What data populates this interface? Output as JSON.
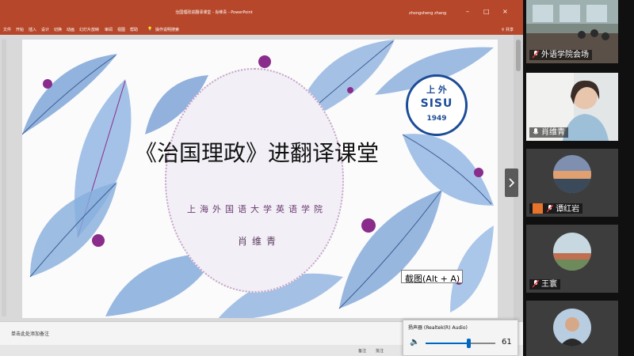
{
  "window": {
    "title": "治国理政进翻译课堂 - 肖维青 - PowerPoint",
    "user_name": "zhongsheng zhang"
  },
  "ribbon": {
    "tabs": [
      "文件",
      "开始",
      "插入",
      "设计",
      "切换",
      "动画",
      "幻灯片放映",
      "审阅",
      "视图",
      "帮助"
    ],
    "tell_me": "操作说明搜索",
    "share": "共享"
  },
  "slide": {
    "title": "《治国理政》进翻译课堂",
    "subtitle": "上海外国语大学英语学院",
    "author": "肖维青",
    "logo": {
      "top": "上 外",
      "middle": "SISU",
      "year": "1949"
    }
  },
  "tooltip": "截图(Alt + A)",
  "notes_placeholder": "单击此处添加备注",
  "status": {
    "notes": "备注",
    "comments": "批注"
  },
  "volume": {
    "device": "扬声器 (Realtek(R) Audio)",
    "value": "61",
    "level_pct": 61
  },
  "participants": [
    {
      "name": "外语学院会场",
      "muted": true
    },
    {
      "name": "肖维青",
      "muted": false
    },
    {
      "name": "谭红岩",
      "muted": true
    },
    {
      "name": "王寰",
      "muted": true
    },
    {
      "name": "",
      "muted": true
    }
  ],
  "colors": {
    "accent": "#b7472a",
    "logo": "#1b4c97",
    "ink": "#8a2c8c",
    "volume": "#0067c0"
  }
}
